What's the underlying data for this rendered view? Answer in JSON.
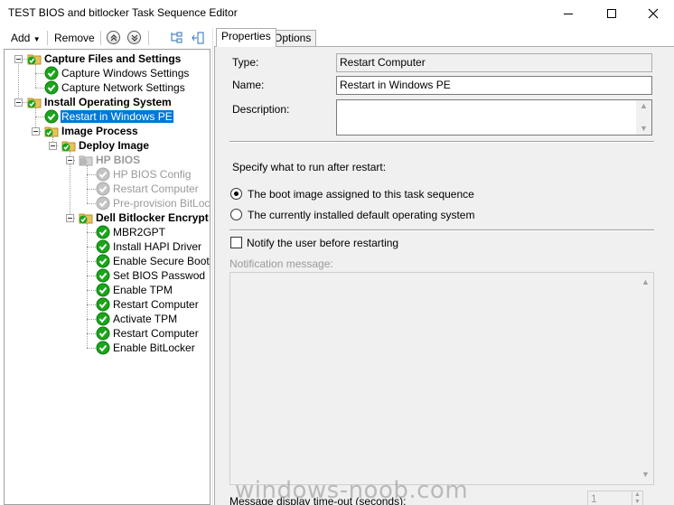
{
  "window": {
    "title": "TEST BIOS and bitlocker Task Sequence Editor"
  },
  "toolbar": {
    "add_label": "Add",
    "remove_label": "Remove"
  },
  "tree": {
    "items": [
      {
        "label": "Capture Files and Settings",
        "type": "group",
        "state": "ok"
      },
      {
        "label": "Capture Windows Settings",
        "type": "step",
        "state": "ok"
      },
      {
        "label": "Capture Network Settings",
        "type": "step",
        "state": "ok"
      },
      {
        "label": "Install Operating System",
        "type": "group",
        "state": "ok"
      },
      {
        "label": "Restart in Windows PE",
        "type": "step",
        "state": "ok",
        "selected": true
      },
      {
        "label": "Image Process",
        "type": "group",
        "state": "ok"
      },
      {
        "label": "Deploy Image",
        "type": "group",
        "state": "ok"
      },
      {
        "label": "HP BIOS",
        "type": "group",
        "state": "disabled"
      },
      {
        "label": "HP BIOS Config",
        "type": "step",
        "state": "disabled"
      },
      {
        "label": "Restart Computer",
        "type": "step",
        "state": "disabled"
      },
      {
        "label": "Pre-provision BitLocke",
        "type": "step",
        "state": "disabled"
      },
      {
        "label": "Dell Bitlocker Encrypt",
        "type": "group",
        "state": "ok"
      },
      {
        "label": "MBR2GPT",
        "type": "step",
        "state": "ok"
      },
      {
        "label": "Install HAPI Driver",
        "type": "step",
        "state": "ok"
      },
      {
        "label": "Enable Secure Boot",
        "type": "step",
        "state": "ok"
      },
      {
        "label": "Set BIOS Passwod",
        "type": "step",
        "state": "ok"
      },
      {
        "label": "Enable TPM",
        "type": "step",
        "state": "ok"
      },
      {
        "label": "Restart Computer",
        "type": "step",
        "state": "ok"
      },
      {
        "label": "Activate TPM",
        "type": "step",
        "state": "ok"
      },
      {
        "label": "Restart Computer",
        "type": "step",
        "state": "ok"
      },
      {
        "label": "Enable BitLocker",
        "type": "step",
        "state": "ok"
      }
    ]
  },
  "tabs": [
    {
      "label": "Properties",
      "active": true
    },
    {
      "label": "Options",
      "active": false
    }
  ],
  "properties": {
    "type_label": "Type:",
    "type_value": "Restart Computer",
    "name_label": "Name:",
    "name_value": "Restart in Windows PE",
    "description_label": "Description:",
    "description_value": "",
    "specify_label": "Specify what to run after restart:",
    "radio_boot_image": "The boot image assigned to this task sequence",
    "radio_installed_os": "The currently installed default operating system",
    "radio_selected": "boot_image",
    "notify_label": "Notify the user before restarting",
    "notify_checked": false,
    "notification_label": "Notification message:",
    "timeout_label": "Message display time-out (seconds):",
    "timeout_value": "1"
  },
  "watermark": "windows-noob.com",
  "colors": {
    "selection": "#0078d7",
    "check_green": "#1aa51a",
    "folder_yellow": "#e8c25a"
  }
}
